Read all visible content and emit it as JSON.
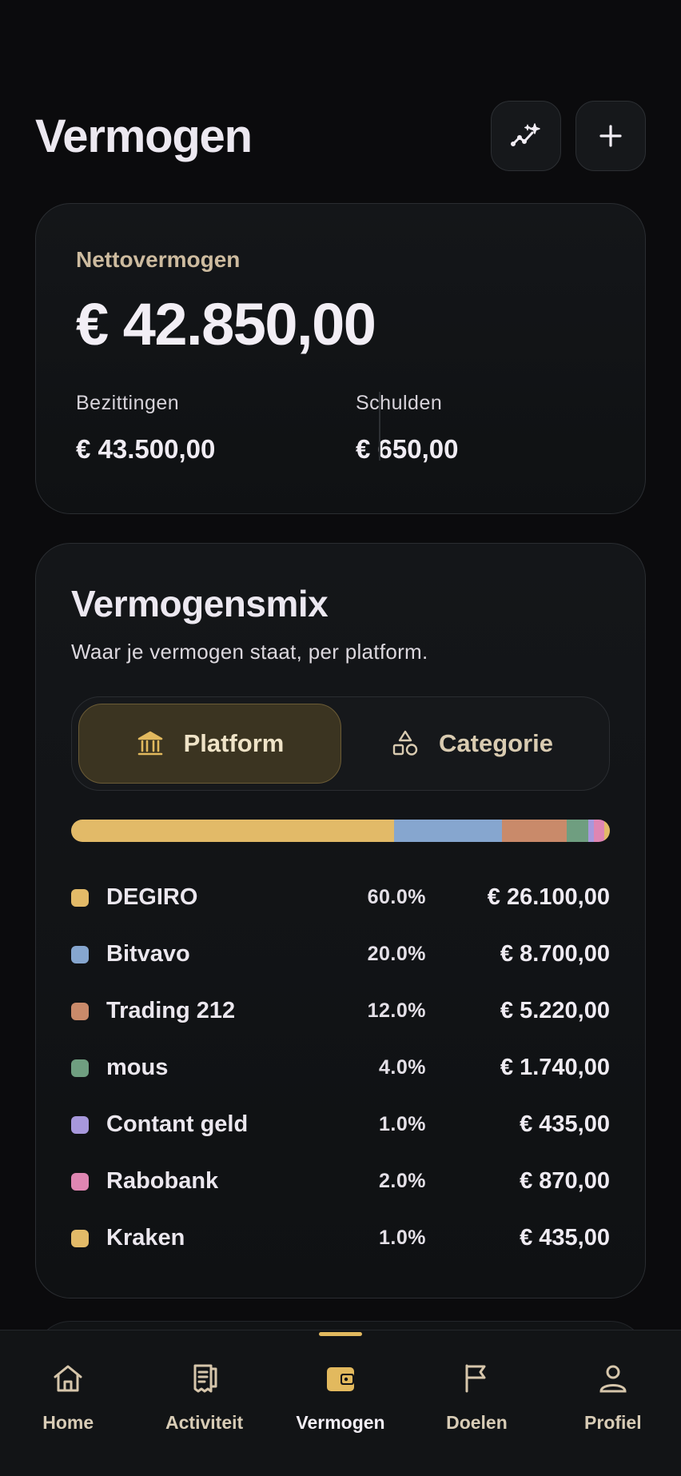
{
  "header": {
    "title": "Vermogen",
    "insights_icon": "sparkle-chart-icon",
    "add_icon": "plus-icon"
  },
  "summary": {
    "label": "Nettovermogen",
    "value": "€ 42.850,00",
    "assets_label": "Bezittingen",
    "assets_value": "€ 43.500,00",
    "debts_label": "Schulden",
    "debts_value": "€ 650,00"
  },
  "mix": {
    "title": "Vermogensmix",
    "subtitle": "Waar je vermogen staat, per platform.",
    "tabs": [
      {
        "label": "Platform",
        "icon": "bank-icon",
        "active": true
      },
      {
        "label": "Categorie",
        "icon": "shapes-icon",
        "active": false
      }
    ],
    "items": [
      {
        "name": "DEGIRO",
        "pct": "60.0%",
        "share": 0.6,
        "amount": "€ 26.100,00",
        "color": "#e2ba68"
      },
      {
        "name": "Bitvavo",
        "pct": "20.0%",
        "share": 0.2,
        "amount": "€ 8.700,00",
        "color": "#86a6cf"
      },
      {
        "name": "Trading 212",
        "pct": "12.0%",
        "share": 0.12,
        "amount": "€ 5.220,00",
        "color": "#c98a6a"
      },
      {
        "name": "mous",
        "pct": "4.0%",
        "share": 0.04,
        "amount": "€ 1.740,00",
        "color": "#6f9e80"
      },
      {
        "name": "Contant geld",
        "pct": "1.0%",
        "share": 0.01,
        "amount": "€ 435,00",
        "color": "#a798dc"
      },
      {
        "name": "Rabobank",
        "pct": "2.0%",
        "share": 0.02,
        "amount": "€ 870,00",
        "color": "#df86b2"
      },
      {
        "name": "Kraken",
        "pct": "1.0%",
        "share": 0.01,
        "amount": "€ 435,00",
        "color": "#e2ba68"
      }
    ]
  },
  "nav": {
    "items": [
      {
        "label": "Home",
        "icon": "home-icon",
        "active": false
      },
      {
        "label": "Activiteit",
        "icon": "receipt-icon",
        "active": false
      },
      {
        "label": "Vermogen",
        "icon": "wallet-icon",
        "active": true
      },
      {
        "label": "Doelen",
        "icon": "flag-icon",
        "active": false
      },
      {
        "label": "Profiel",
        "icon": "user-icon",
        "active": false
      }
    ],
    "accent": "#e2b95e"
  }
}
